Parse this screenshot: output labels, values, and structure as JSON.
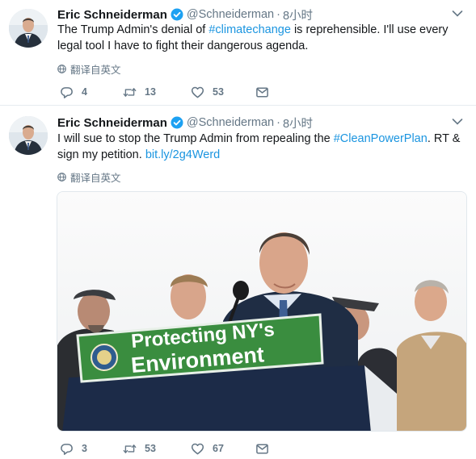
{
  "tweets": [
    {
      "author_name": "Eric Schneiderman",
      "handle": "@Schneiderman",
      "separator": "·",
      "time": "8小时",
      "text_before": "The Trump Admin's denial of ",
      "hashtag": "#climatechange",
      "text_after": " is reprehensible. I'll use every legal tool I have to fight their dangerous agenda.",
      "translate_label": "翻译自英文",
      "reply_count": "4",
      "retweet_count": "13",
      "like_count": "53"
    },
    {
      "author_name": "Eric Schneiderman",
      "handle": "@Schneiderman",
      "separator": "·",
      "time": "8小时",
      "text_before": "I will sue to stop the Trump Admin from repealing the ",
      "hashtag": "#CleanPowerPlan",
      "text_after": ". RT & sign my petition. ",
      "link": "bit.ly/2g4Werd",
      "translate_label": "翻译自英文",
      "reply_count": "3",
      "retweet_count": "53",
      "like_count": "67",
      "photo_sign_line1": "Protecting NY's",
      "photo_sign_line2": "Environment"
    }
  ],
  "colors": {
    "verified": "#1da1f2",
    "link": "#1b95e0",
    "meta": "#657786",
    "sign": "#3a8d3f"
  },
  "icons": {
    "verified": "verified-badge-icon",
    "caret": "chevron-down-icon",
    "translate": "globe-icon",
    "reply": "reply-icon",
    "retweet": "retweet-icon",
    "like": "heart-icon",
    "message": "direct-message-icon"
  }
}
